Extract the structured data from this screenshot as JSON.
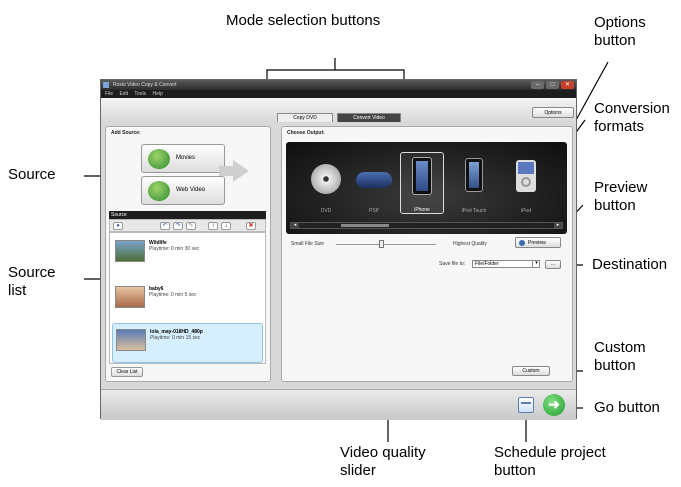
{
  "callouts": {
    "mode_selection": "Mode selection buttons",
    "options_button": "Options button",
    "conversion_formats": "Conversion formats",
    "source": "Source",
    "preview_button": "Preview button",
    "source_list": "Source list",
    "destination": "Destination",
    "custom_button": "Custom button",
    "go_button": "Go button",
    "video_quality_slider": "Video quality slider",
    "schedule_project_button": "Schedule project button"
  },
  "window": {
    "title": "Roxio Video Copy & Convert",
    "menu": [
      "File",
      "Edit",
      "Tools",
      "Help"
    ],
    "controls": {
      "minimize": "–",
      "maximize": "□",
      "close": "✕"
    }
  },
  "mode_tabs": [
    "Copy DVD",
    "Convert Video"
  ],
  "active_mode": "Convert Video",
  "options_label": "Options",
  "add_source": {
    "label": "Add Source:",
    "buttons": [
      {
        "label": "Movies",
        "icon": "movies-globe-icon"
      },
      {
        "label": "Web Video",
        "icon": "web-video-globe-icon"
      }
    ]
  },
  "source_list": {
    "header": "Source",
    "toolbar_icons": [
      "add-icon",
      "undo-icon",
      "redo-icon",
      "edit-icon",
      "move-up-icon",
      "move-down-icon",
      "delete-icon"
    ],
    "items": [
      {
        "name": "Wildlife",
        "playtime": "Playtime: 0 min 30 sec",
        "selected": false
      },
      {
        "name": "baby6",
        "playtime": "Playtime: 0 min 5 sec",
        "selected": false
      },
      {
        "name": "lola_may-018HD_480p",
        "playtime": "Playtime: 0 min 15 sec",
        "selected": true
      }
    ],
    "clear_label": "Clear List"
  },
  "output": {
    "label": "Choose Output:",
    "formats": [
      {
        "label": "DVD",
        "selected": false
      },
      {
        "label": "PSP",
        "selected": false
      },
      {
        "label": "iPhone",
        "selected": true
      },
      {
        "label": "iPod Touch",
        "selected": false
      },
      {
        "label": "iPod",
        "selected": false
      }
    ],
    "quality_min_label": "Small File Size",
    "quality_max_label": "Highest Quality",
    "quality_level": 0.45,
    "preview_label": "Preview",
    "save_label": "Save file to:",
    "save_value": "File/Folder",
    "browse_label": "...",
    "custom_label": "Custom"
  },
  "colors": {
    "accent": "#3a6ab0",
    "go": "#1f9a2f",
    "selected_item": "#d6efff"
  }
}
